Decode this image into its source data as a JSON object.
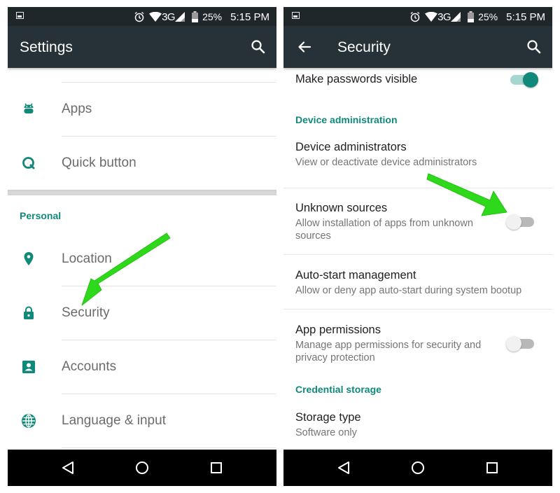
{
  "status_bar": {
    "battery": "25%",
    "time": "5:15 PM",
    "network": "3G",
    "icons": [
      "image-notification-icon",
      "alarm-icon",
      "wifi-icon",
      "signal-icon",
      "battery-icon"
    ]
  },
  "left_screen": {
    "toolbar": {
      "title": "Settings",
      "search_icon": "search-icon"
    },
    "items_top": [
      {
        "label": "Apps",
        "icon": "android-icon"
      },
      {
        "label": "Quick button",
        "icon": "quick-button-icon"
      }
    ],
    "section_personal": "Personal",
    "items_personal": [
      {
        "label": "Location",
        "icon": "location-pin-icon"
      },
      {
        "label": "Security",
        "icon": "lock-icon"
      },
      {
        "label": "Accounts",
        "icon": "account-icon"
      },
      {
        "label": "Language & input",
        "icon": "globe-icon"
      }
    ],
    "annotation": "green arrow pointing to Security"
  },
  "right_screen": {
    "toolbar": {
      "title": "Security",
      "back_icon": "back-arrow-icon",
      "search_icon": "search-icon"
    },
    "make_passwords_visible": {
      "title": "Make passwords visible",
      "enabled": true
    },
    "section_device_admin": "Device administration",
    "device_administrators": {
      "title": "Device administrators",
      "subtitle": "View or deactivate device administrators"
    },
    "unknown_sources": {
      "title": "Unknown sources",
      "subtitle_line1": "Allow installation of apps from unknown",
      "subtitle_line2": "sources",
      "enabled": false
    },
    "auto_start": {
      "title": "Auto-start management",
      "subtitle": "Allow or deny app auto-start during system bootup"
    },
    "app_permissions": {
      "title": "App permissions",
      "subtitle_line1": "Manage app permissions for security and",
      "subtitle_line2": "privacy protection",
      "enabled": false
    },
    "section_credential": "Credential storage",
    "storage_type": {
      "title": "Storage type",
      "subtitle": "Software only"
    },
    "annotation": "green arrow pointing to Unknown sources toggle"
  },
  "colors": {
    "accent": "#11897a",
    "toolbar": "#263238",
    "status_bar": "#20272b",
    "annotation_arrow": "#2ed81a"
  }
}
